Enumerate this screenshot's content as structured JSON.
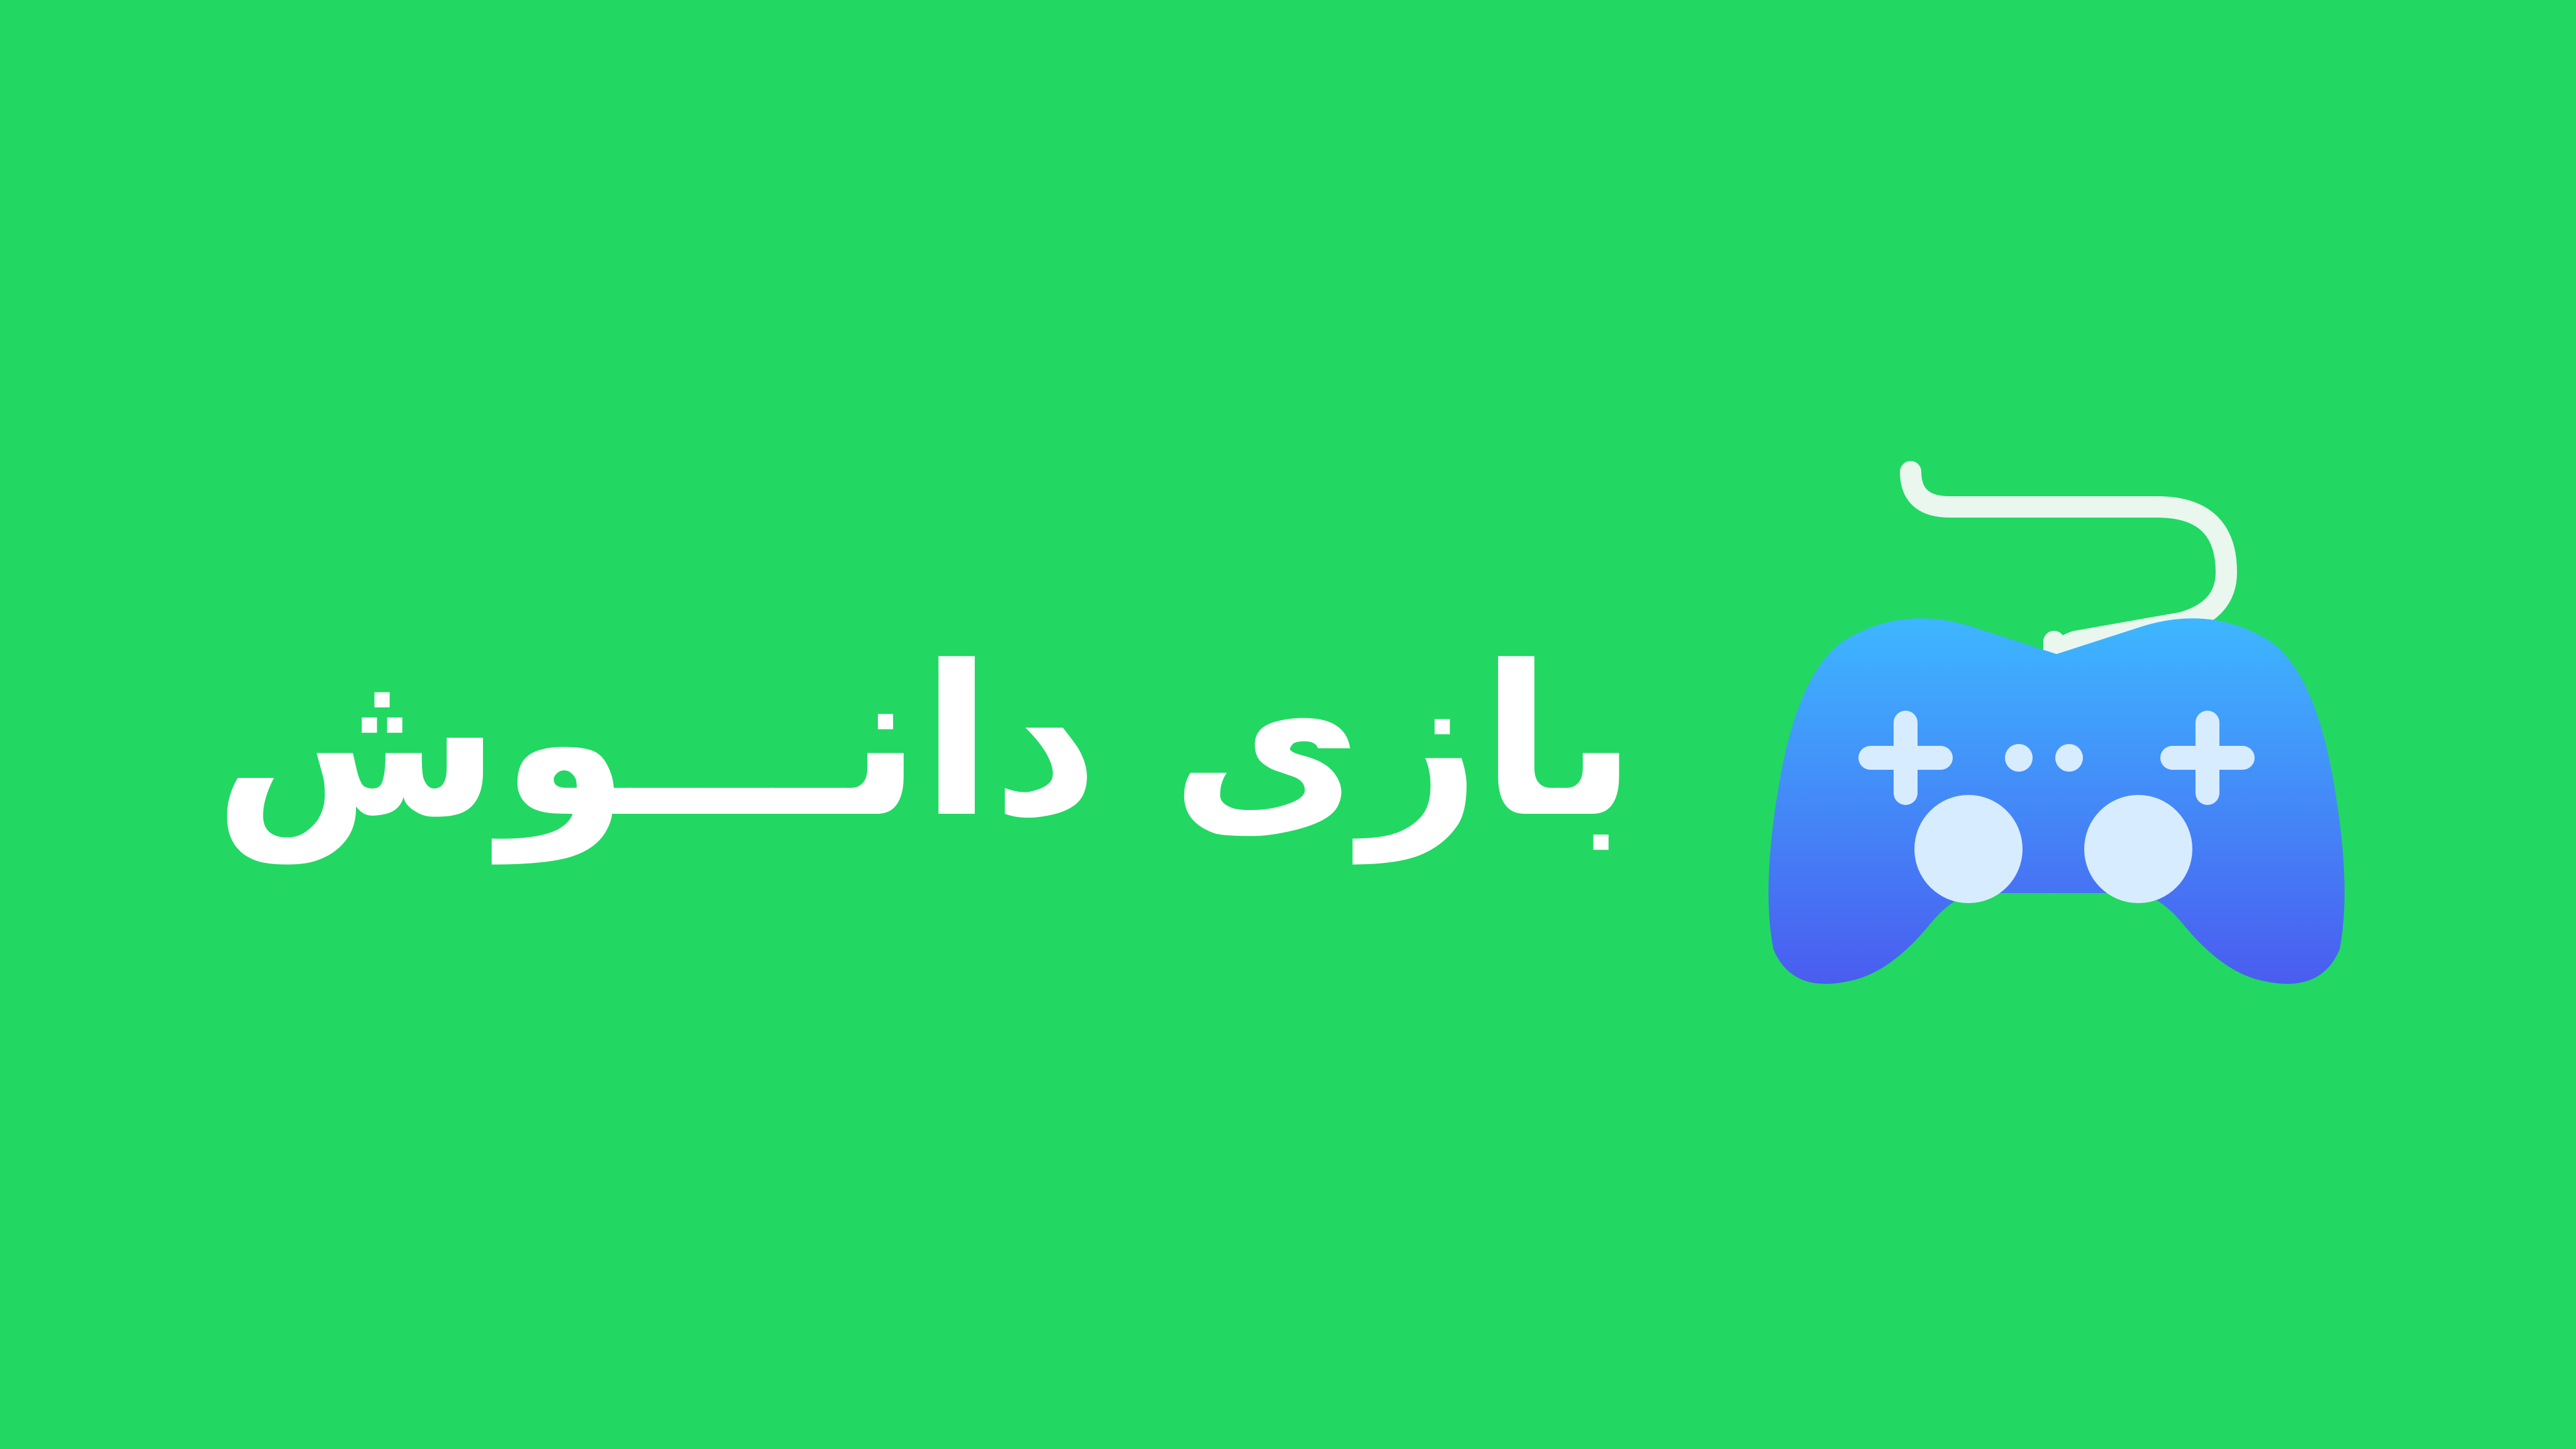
{
  "brand": {
    "title": "بازی دانـــوش"
  },
  "icons": {
    "logo": "gamepad-icon"
  },
  "colors": {
    "background": "#22d862",
    "title": "#ffffff",
    "gamepad_top": "#3db7ff",
    "gamepad_bottom": "#4a5cf0",
    "gamepad_details": "#d8ecff",
    "cable": "#e9f7ef"
  }
}
